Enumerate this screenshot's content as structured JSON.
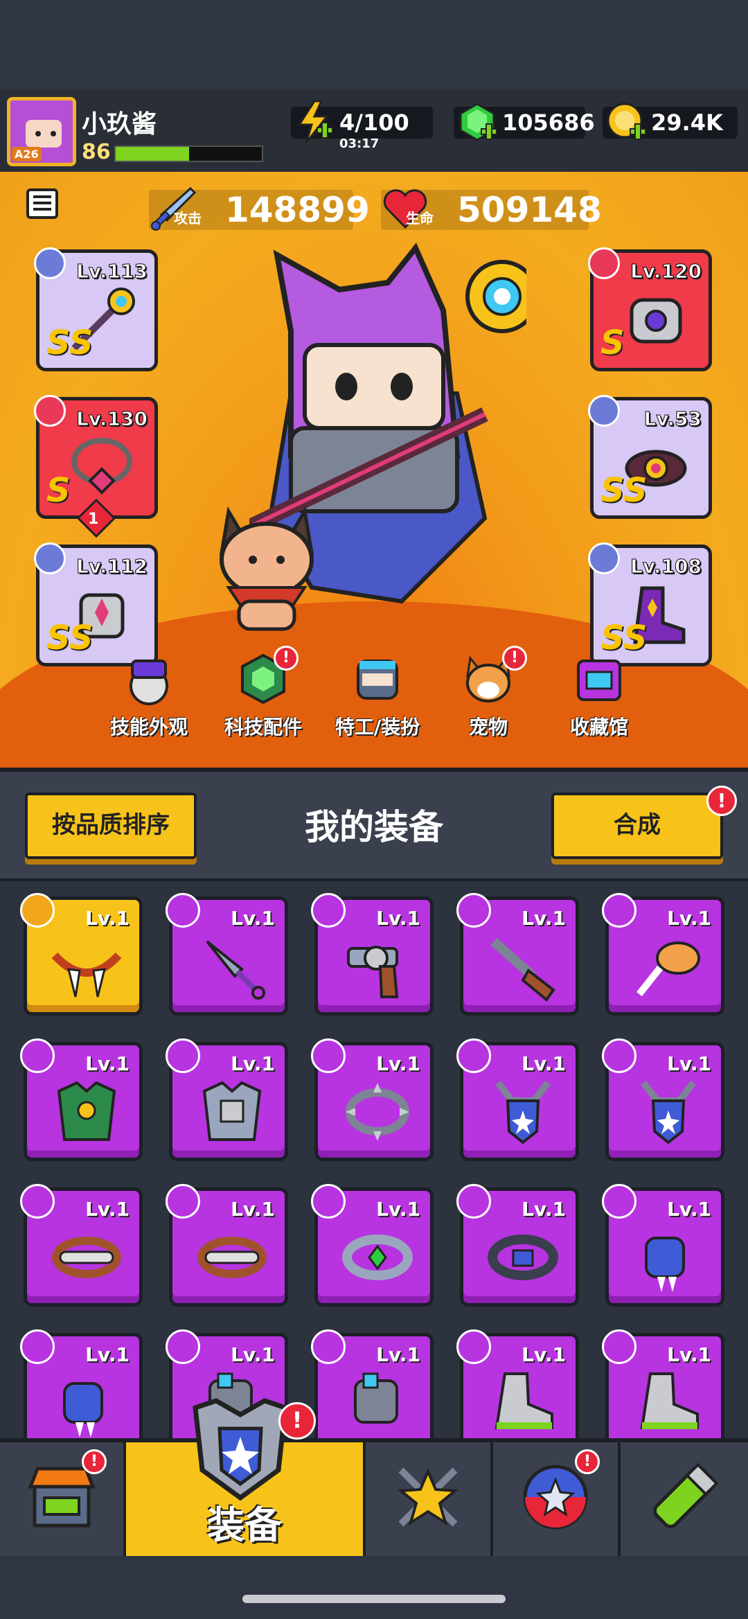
{
  "player": {
    "name": "小玖酱",
    "level": "86",
    "badge": "A26",
    "xp_fraction": 0.5
  },
  "resources": {
    "energy": {
      "value": "4/100",
      "timer": "03:17",
      "icon": "lightning-icon"
    },
    "gems": {
      "value": "105686",
      "icon": "green-gem-icon"
    },
    "coins": {
      "value": "29.4K",
      "icon": "gold-coin-icon"
    }
  },
  "stats": {
    "attack": {
      "value": "148899",
      "label": "攻击",
      "icon": "sword-icon"
    },
    "hp": {
      "value": "509148",
      "label": "生命",
      "icon": "heart-icon"
    }
  },
  "equipped": [
    {
      "slot": "weapon",
      "level": "Lv.113",
      "rank": "SS"
    },
    {
      "slot": "necklace",
      "level": "Lv.130",
      "rank": "S",
      "stars": "1"
    },
    {
      "slot": "gloves",
      "level": "Lv.112",
      "rank": "SS"
    },
    {
      "slot": "armor",
      "level": "Lv.120",
      "rank": "S"
    },
    {
      "slot": "belt",
      "level": "Lv.53",
      "rank": "SS"
    },
    {
      "slot": "boots",
      "level": "Lv.108",
      "rank": "SS"
    }
  ],
  "sub_menu": [
    {
      "label": "技能外观",
      "badge": false
    },
    {
      "label": "科技配件",
      "badge": true
    },
    {
      "label": "特工/装扮",
      "badge": false
    },
    {
      "label": "宠物",
      "badge": true
    },
    {
      "label": "收藏馆",
      "badge": false
    }
  ],
  "inventory": {
    "title": "我的装备",
    "sort_button": "按品质排序",
    "merge_button": "合成",
    "badge_text": "!",
    "items": [
      {
        "level": "Lv.1",
        "kind": "fang-necklace",
        "rarity": "gold"
      },
      {
        "level": "Lv.1",
        "kind": "kunai",
        "rarity": "epic"
      },
      {
        "level": "Lv.1",
        "kind": "revolver",
        "rarity": "epic"
      },
      {
        "level": "Lv.1",
        "kind": "shotgun",
        "rarity": "epic"
      },
      {
        "level": "Lv.1",
        "kind": "drumstick",
        "rarity": "epic"
      },
      {
        "level": "Lv.1",
        "kind": "leaf-armor",
        "rarity": "epic"
      },
      {
        "level": "Lv.1",
        "kind": "steel-armor",
        "rarity": "epic"
      },
      {
        "level": "Lv.1",
        "kind": "spiked-collar",
        "rarity": "epic"
      },
      {
        "level": "Lv.1",
        "kind": "shield-pendant",
        "rarity": "epic"
      },
      {
        "level": "Lv.1",
        "kind": "shield-pendant",
        "rarity": "epic"
      },
      {
        "level": "Lv.1",
        "kind": "bone-belt",
        "rarity": "epic"
      },
      {
        "level": "Lv.1",
        "kind": "bone-belt",
        "rarity": "epic"
      },
      {
        "level": "Lv.1",
        "kind": "gem-belt",
        "rarity": "epic"
      },
      {
        "level": "Lv.1",
        "kind": "star-belt",
        "rarity": "epic"
      },
      {
        "level": "Lv.1",
        "kind": "claw-glove",
        "rarity": "epic"
      },
      {
        "level": "Lv.1",
        "kind": "claw-glove",
        "rarity": "epic"
      },
      {
        "level": "Lv.1",
        "kind": "mech-glove",
        "rarity": "epic"
      },
      {
        "level": "Lv.1",
        "kind": "mech-glove",
        "rarity": "epic"
      },
      {
        "level": "Lv.1",
        "kind": "sneaker",
        "rarity": "epic"
      },
      {
        "level": "Lv.1",
        "kind": "sneaker",
        "rarity": "epic"
      }
    ]
  },
  "bottom_nav": [
    {
      "name": "shop",
      "label": "",
      "icon": "shop-icon",
      "badge": true
    },
    {
      "name": "equipment",
      "label": "装备",
      "icon": "armor-icon",
      "badge": true,
      "active": true
    },
    {
      "name": "battle",
      "label": "",
      "icon": "crossed-swords-star-icon",
      "badge": false
    },
    {
      "name": "talent",
      "label": "",
      "icon": "star-ball-icon",
      "badge": true
    },
    {
      "name": "evolve",
      "label": "",
      "icon": "dna-capsule-icon",
      "badge": false
    }
  ],
  "colors": {
    "hero_bg": "#f29b1a",
    "epic": "#b734e0",
    "gold": "#f7c31a",
    "red": "#ef3b4a",
    "rare": "#d7c8f5"
  }
}
